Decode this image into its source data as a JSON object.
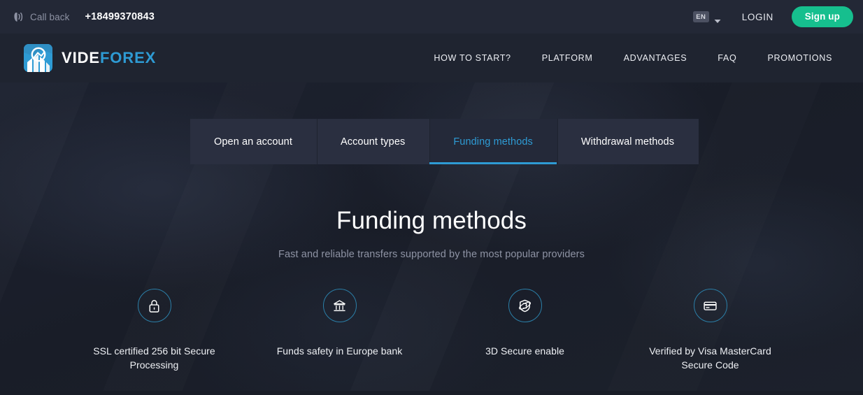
{
  "topbar": {
    "callback_icon": "phone-waves-icon",
    "callback_label": "Call back",
    "phone_number": "+18499370843",
    "language": "EN",
    "language_chevron_icon": "chevron-down-icon",
    "login_label": "LOGIN",
    "signup_label": "Sign up",
    "signup_color": "#16bf8e",
    "background": "#232836"
  },
  "header": {
    "logo": {
      "icon": "videforex-chart-logo-icon",
      "text_primary": "VIDE",
      "text_secondary": "FOREX",
      "primary_color": "#ffffff",
      "secondary_color": "#2e9bd4"
    },
    "nav": [
      {
        "label": "HOW TO START?"
      },
      {
        "label": "PLATFORM"
      },
      {
        "label": "ADVANTAGES"
      },
      {
        "label": "FAQ"
      },
      {
        "label": "PROMOTIONS"
      }
    ],
    "background": "#1f2430"
  },
  "tabs": [
    {
      "label": "Open an account",
      "active": false
    },
    {
      "label": "Account types",
      "active": false
    },
    {
      "label": "Funding methods",
      "active": true
    },
    {
      "label": "Withdrawal methods",
      "active": false
    }
  ],
  "tab_accent_color": "#2e9bd4",
  "main": {
    "title": "Funding methods",
    "subtitle": "Fast and reliable transfers supported by the most popular providers",
    "features": [
      {
        "icon": "lock-icon",
        "label": "SSL certified 256 bit Secure Processing"
      },
      {
        "icon": "bank-icon",
        "label": "Funds safety in Europe bank"
      },
      {
        "icon": "shield-3d-icon",
        "label": "3D Secure enable"
      },
      {
        "icon": "credit-card-icon",
        "label": "Verified by Visa MasterCard Secure Code"
      }
    ],
    "feature_circle_color": "#2b7fa8",
    "background": "#1b1f2b"
  }
}
